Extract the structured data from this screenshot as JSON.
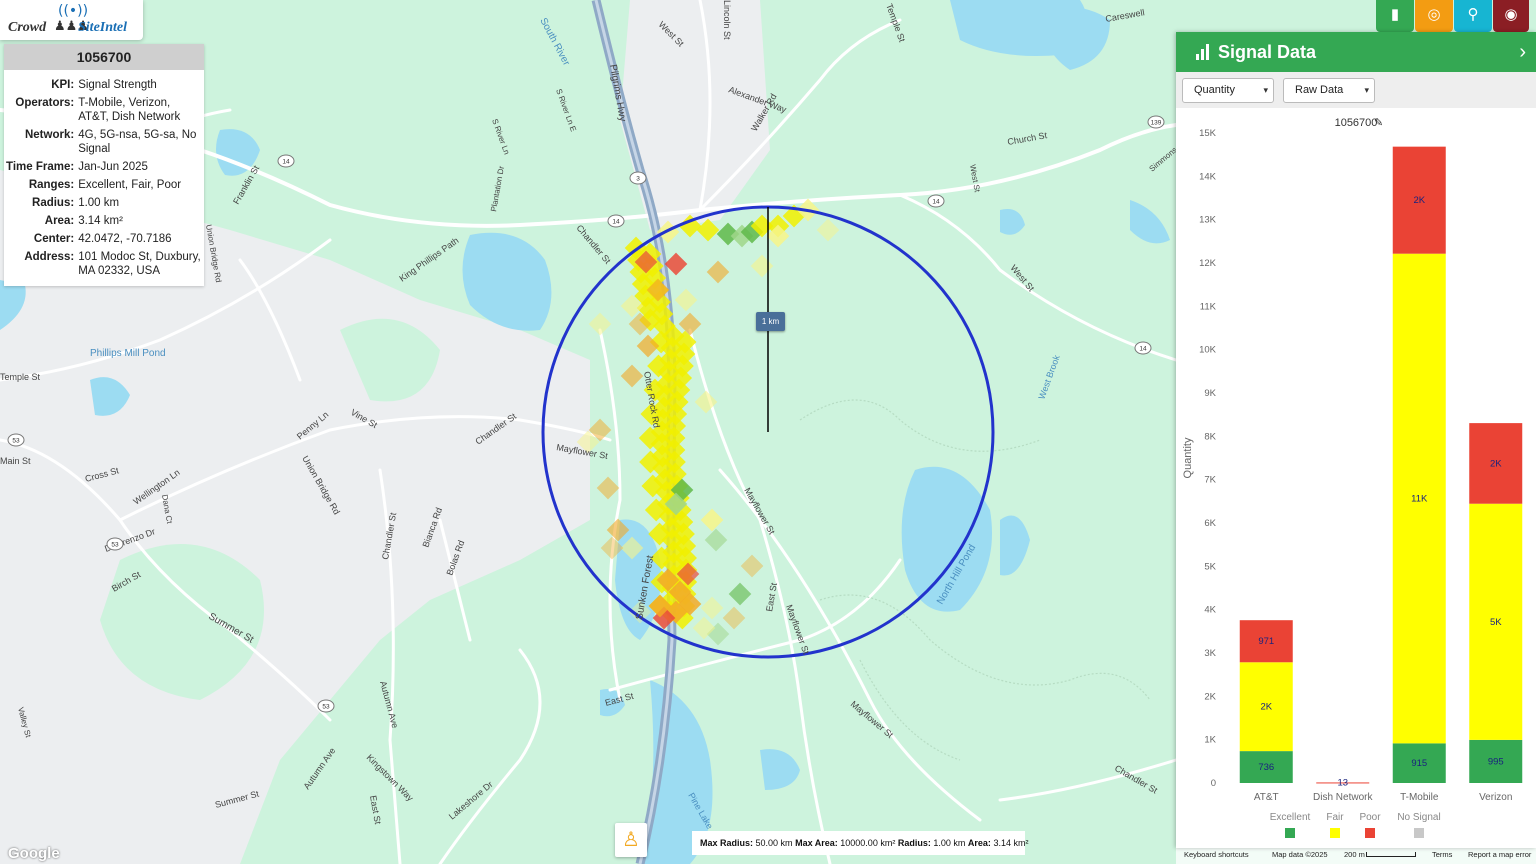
{
  "logo": {
    "signal_glyph": "((•))",
    "crowd_text": "Crowd",
    "site_text": "SiteIntel"
  },
  "info_panel": {
    "header": "1056700",
    "rows": [
      {
        "key": "KPI:",
        "value": "Signal Strength"
      },
      {
        "key": "Operators:",
        "value": "T-Mobile, Verizon, AT&T, Dish Network"
      },
      {
        "key": "Network:",
        "value": "4G, 5G-nsa, 5G-sa, No Signal"
      },
      {
        "key": "Time Frame:",
        "value": "Jan-Jun 2025"
      },
      {
        "key": "Ranges:",
        "value": "Excellent, Fair, Poor"
      },
      {
        "key": "Radius:",
        "value": "1.00 km"
      },
      {
        "key": "Area:",
        "value": "3.14 km²"
      },
      {
        "key": "Center:",
        "value": "42.0472, -70.7186"
      },
      {
        "key": "Address:",
        "value": "101 Modoc St, Duxbury, MA 02332, USA"
      }
    ]
  },
  "map": {
    "scale_label": "1 km",
    "labels": [
      "Pilgrims Hwy",
      "South River",
      "West St",
      "Lincoln St",
      "Alexander Way",
      "Walker Rd",
      "Temple St",
      "Church St",
      "Careswell",
      "Simmons",
      "West St",
      "Franklin St",
      "Union Bridge Rd",
      "Plantation Dr",
      "S River Ln",
      "S River Ln E",
      "Chandler St",
      "King Phillips Path",
      "Phillips Mill Pond",
      "Otter Rock Rd",
      "Mayflower St",
      "Vine St",
      "Penny Ln",
      "Union Bridge Rd",
      "Chandler St",
      "Cross St",
      "Wellington Ln",
      "Dana Ct",
      "Delorenzo Dr",
      "Birch St",
      "Chandler St",
      "Bianca Rd",
      "Bolas Rd",
      "Summer St",
      "Sunken Forest",
      "East St",
      "Mayflower St",
      "North Hill Pond",
      "West Brook",
      "East St",
      "Pine Lake",
      "Mayflower St",
      "Mayflower St",
      "Chandler St",
      "Autumn Ave",
      "Autumn Ave",
      "Summer St",
      "Kingstown Way",
      "East St",
      "Lakeshore Dr",
      "Valley St",
      "Main St",
      "Temple St",
      "West St"
    ],
    "route_shields": [
      "14",
      "14",
      "3",
      "14",
      "139",
      "14",
      "53",
      "53",
      "53"
    ],
    "bottom_stats": {
      "max_radius_label": "Max Radius:",
      "max_radius": "50.00 km",
      "max_area_label": "Max Area:",
      "max_area": "10000.00 km²",
      "radius_label": "Radius:",
      "radius": "1.00 km",
      "area_label": "Area:",
      "area": "3.14 km²"
    },
    "google_logo": "Google",
    "attribution": {
      "shortcuts": "Keyboard shortcuts",
      "map_data": "Map data ©2025",
      "scale": "200 m",
      "terms": "Terms",
      "report": "Report a map error"
    }
  },
  "top_buttons": [
    {
      "name": "chart-button",
      "icon": "bar-chart-icon",
      "color": "#34a853"
    },
    {
      "name": "target-button",
      "icon": "target-icon",
      "color": "#f39c12"
    },
    {
      "name": "location-button",
      "icon": "map-pin-icon",
      "color": "#17b5d2"
    },
    {
      "name": "globe-button",
      "icon": "globe-icon",
      "color": "#8b1e24"
    }
  ],
  "signal_panel": {
    "title": "Signal Data",
    "metric_select": "Quantity",
    "data_select": "Raw Data",
    "site_id": "1056700"
  },
  "colors": {
    "excellent": "#34a853",
    "fair": "#ffff00",
    "poor": "#ea4335",
    "no_signal": "#c8c8c8",
    "circle": "#2233cc"
  },
  "chart_data": {
    "type": "bar",
    "stacked": true,
    "title": "1056700",
    "ylabel": "Quantity",
    "ylim": [
      0,
      15000
    ],
    "yticks": [
      "0",
      "1K",
      "2K",
      "3K",
      "4K",
      "5K",
      "6K",
      "7K",
      "8K",
      "9K",
      "10K",
      "11K",
      "12K",
      "13K",
      "14K",
      "15K"
    ],
    "categories": [
      "AT&T",
      "Dish Network",
      "T-Mobile",
      "Verizon"
    ],
    "series": [
      {
        "name": "Excellent",
        "color": "#34a853",
        "values": [
          736,
          0,
          915,
          995
        ],
        "labels": [
          "736",
          "",
          "915",
          "995"
        ]
      },
      {
        "name": "Fair",
        "color": "#ffff00",
        "values": [
          2050,
          0,
          11300,
          5450
        ],
        "labels": [
          "2K",
          "",
          "11K",
          "5K"
        ]
      },
      {
        "name": "Poor",
        "color": "#ea4335",
        "values": [
          971,
          13,
          2470,
          1860
        ],
        "labels": [
          "971",
          "13",
          "2K",
          "2K"
        ]
      },
      {
        "name": "No Signal",
        "color": "#c8c8c8",
        "values": [
          0,
          0,
          0,
          0
        ],
        "labels": [
          "",
          "",
          "",
          ""
        ]
      }
    ],
    "legend": "bottom"
  }
}
